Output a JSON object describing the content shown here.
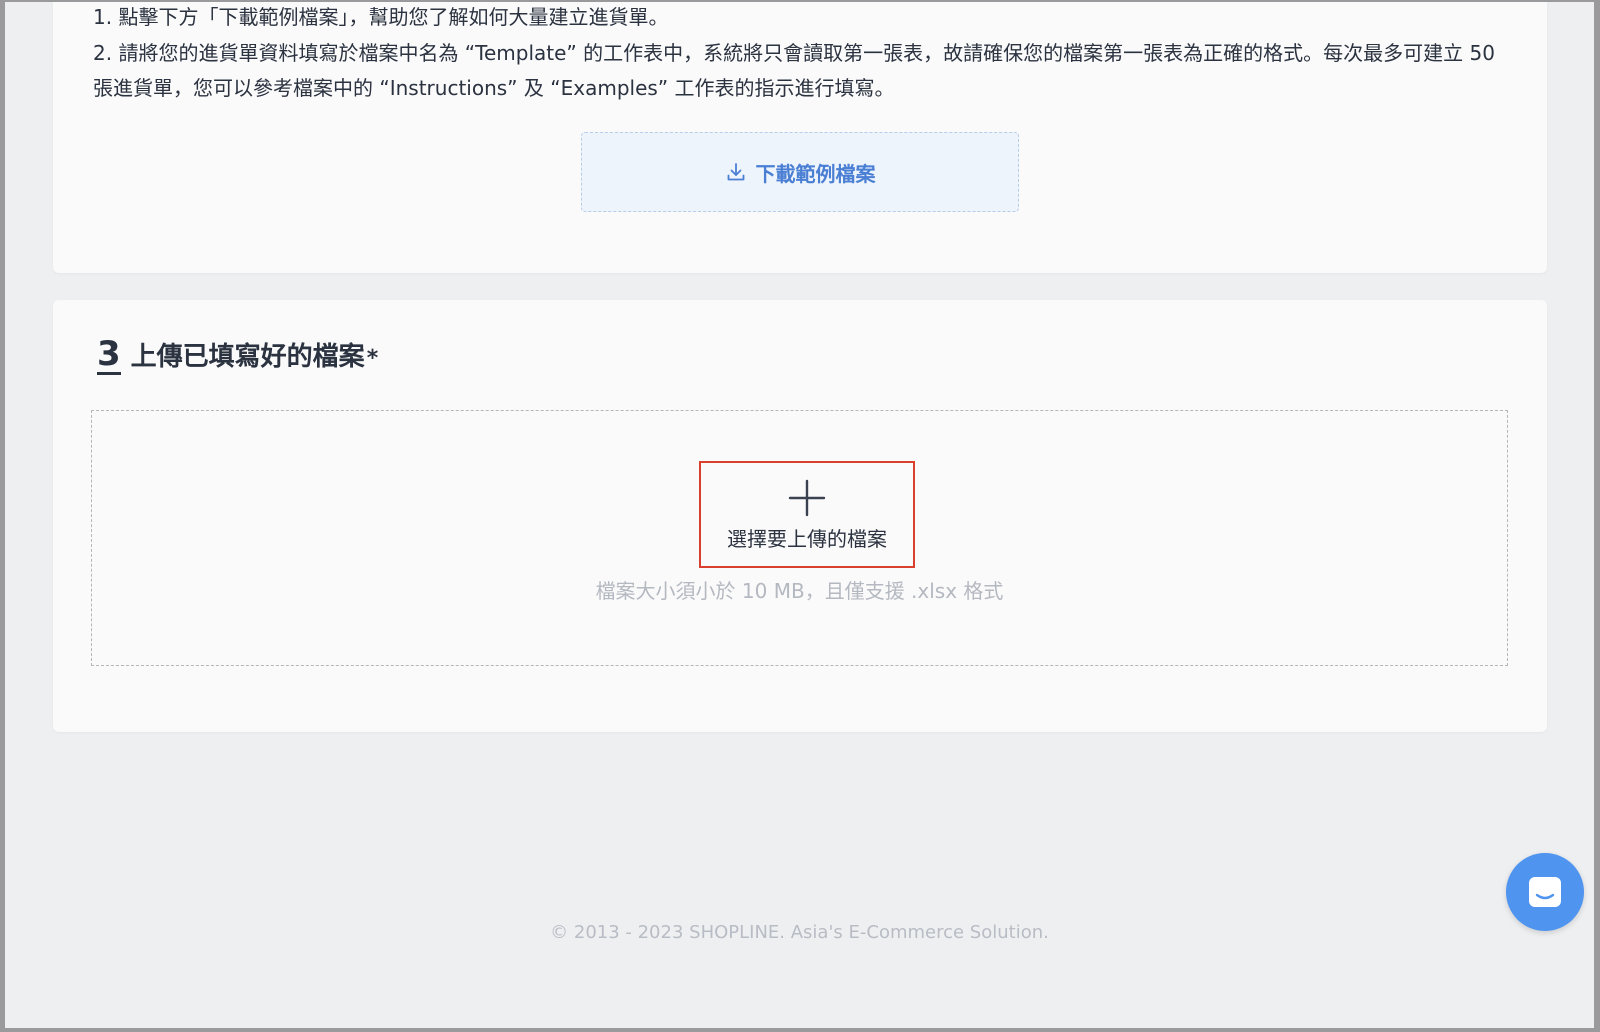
{
  "instructions": {
    "step1": "1. 點擊下方「下載範例檔案」，幫助您了解如何大量建立進貨單。",
    "step2": "2. 請將您的進貨單資料填寫於檔案中名為 “Template” 的工作表中，系統將只會讀取第一張表，故請確保您的檔案第一張表為正確的格式。每次最多可建立 50 張進貨單，您可以參考檔案中的 “Instructions” 及 “Examples” 工作表的指示進行填寫。"
  },
  "download": {
    "label": "下載範例檔案",
    "icon": "download-icon",
    "color": "#4a7fd4"
  },
  "upload_section": {
    "step_number": "3",
    "title": "上傳已填寫好的檔案",
    "required_mark": "*",
    "choose_label": "選擇要上傳的檔案",
    "choose_icon": "plus-icon",
    "hint": "檔案大小須小於 10 MB，且僅支援 .xlsx 格式",
    "highlight_color": "#d9412e"
  },
  "footer": {
    "copyright": "© 2013 - 2023 SHOPLINE. Asia's E-Commerce Solution."
  },
  "chat": {
    "icon": "chat-icon",
    "color": "#4f94ef"
  }
}
